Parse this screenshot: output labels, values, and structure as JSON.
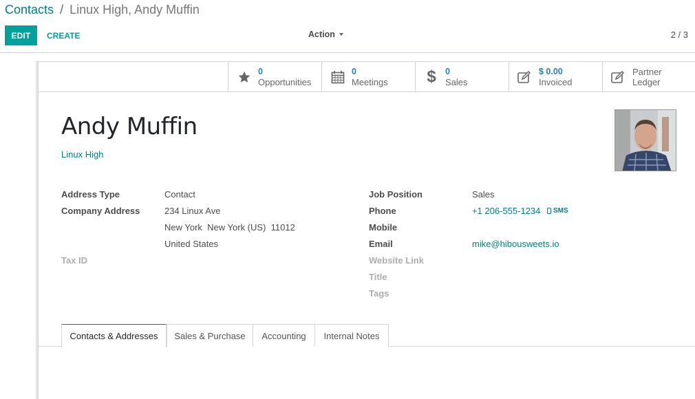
{
  "breadcrumb": {
    "parent": "Contacts",
    "separator": "/",
    "current": "Linux High, Andy Muffin"
  },
  "toolbar": {
    "edit_label": "EDIT",
    "create_label": "CREATE",
    "action_label": "Action",
    "pager": "2 / 3"
  },
  "colors": {
    "primary": "#00a09d",
    "link": "#017e84",
    "stat_value": "#2b80b0"
  },
  "stat_buttons": [
    {
      "icon": "star-icon",
      "value": "0",
      "label": "Opportunities"
    },
    {
      "icon": "calendar-icon",
      "value": "0",
      "label": "Meetings"
    },
    {
      "icon": "dollar-icon",
      "value": "0",
      "label": "Sales"
    },
    {
      "icon": "edit-square-icon",
      "value": "$ 0.00",
      "label": "Invoiced"
    },
    {
      "icon": "edit-square-icon",
      "label_line1": "Partner",
      "label_line2": "Ledger"
    }
  ],
  "record": {
    "name": "Andy Muffin",
    "company": "Linux High"
  },
  "left_fields": {
    "address_type_label": "Address Type",
    "address_type_value": "Contact",
    "company_address_label": "Company Address",
    "street": "234 Linux Ave",
    "city_line": "New York  New York (US)  11012",
    "country": "United States",
    "tax_id_label": "Tax ID"
  },
  "right_fields": {
    "job_position_label": "Job Position",
    "job_position_value": "Sales",
    "phone_label": "Phone",
    "phone_value": "+1 206-555-1234",
    "sms_label": "SMS",
    "mobile_label": "Mobile",
    "email_label": "Email",
    "email_value": "mike@hibousweets.io",
    "website_label": "Website Link",
    "title_label": "Title",
    "tags_label": "Tags"
  },
  "tabs": [
    {
      "label": "Contacts & Addresses",
      "active": true
    },
    {
      "label": "Sales & Purchase",
      "active": false
    },
    {
      "label": "Accounting",
      "active": false
    },
    {
      "label": "Internal Notes",
      "active": false
    }
  ]
}
